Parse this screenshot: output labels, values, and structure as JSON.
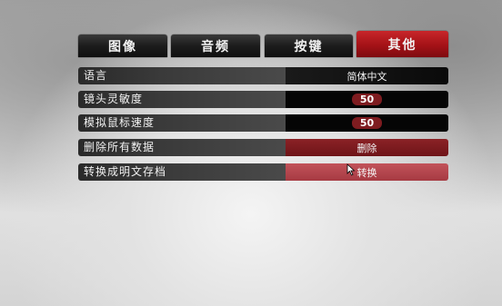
{
  "tabs": [
    {
      "label": "图像"
    },
    {
      "label": "音频"
    },
    {
      "label": "按键"
    },
    {
      "label": "其他"
    }
  ],
  "active_tab": "其他",
  "settings": [
    {
      "label": "语言",
      "value": "简体中文"
    },
    {
      "label": "镜头灵敏度",
      "value": "50"
    },
    {
      "label": "模拟鼠标速度",
      "value": "50"
    },
    {
      "label": "删除所有数据",
      "value": "删除"
    },
    {
      "label": "转换成明文存档",
      "value": "转换"
    }
  ],
  "colors": {
    "accent_red": "#a41217",
    "highlight_red": "#a63a42",
    "dark_bar": "#1a1a1a"
  }
}
